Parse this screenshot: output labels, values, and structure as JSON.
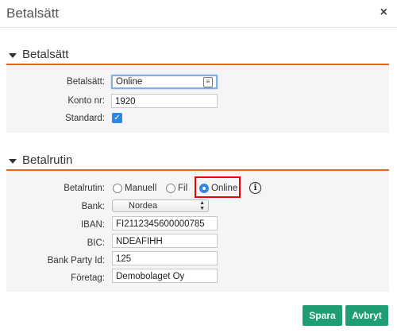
{
  "dialog": {
    "title": "Betalsätt",
    "close_glyph": "×"
  },
  "section1": {
    "title": "Betalsätt",
    "betalsatt_label": "Betalsätt:",
    "betalsatt_value": "Online",
    "konto_label": "Konto nr:",
    "konto_value": "1920",
    "standard_label": "Standard:",
    "standard_checked": true,
    "check_glyph": "✓",
    "contact_icon_glyph": "≡"
  },
  "section2": {
    "title": "Betalrutin",
    "betalrutin_label": "Betalrutin:",
    "options": [
      "Manuell",
      "Fil",
      "Online"
    ],
    "selected_option": "Online",
    "info_glyph": "i",
    "bank_label": "Bank:",
    "bank_value": "Nordea",
    "iban_label": "IBAN:",
    "iban_value": "FI2112345600000785",
    "bic_label": "BIC:",
    "bic_value": "NDEAFIHH",
    "party_label": "Bank Party Id:",
    "party_value": "125",
    "foretag_label": "Företag:",
    "foretag_value": "Demobolaget Oy"
  },
  "buttons": {
    "save": "Spara",
    "cancel": "Avbryt"
  },
  "colors": {
    "accent_line": "#e8641b",
    "button": "#1f9e72",
    "checkbox": "#2f87e5",
    "highlight": "#ee0000"
  }
}
